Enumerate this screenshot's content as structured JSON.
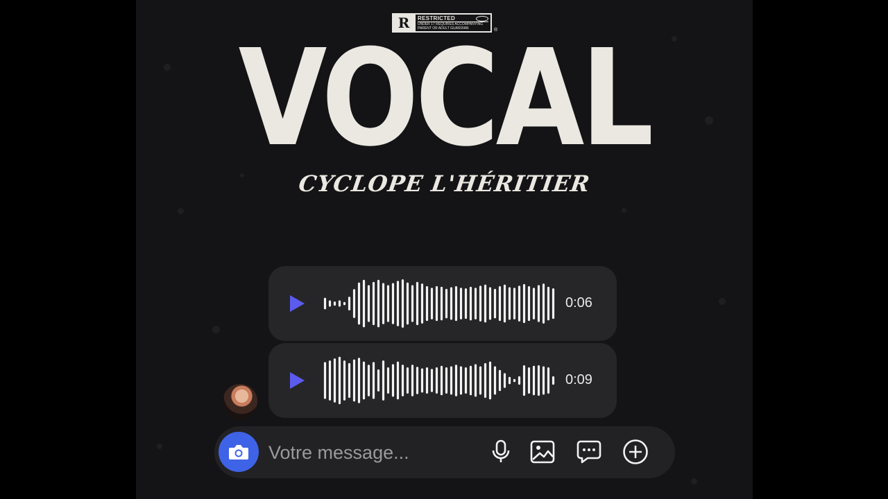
{
  "cover": {
    "advisory": {
      "letter": "R",
      "title": "RESTRICTED",
      "note_line1": "UNDER 17 REQUIRES ACCOMPANYING",
      "note_line2": "PARENT OR ADULT GUARDIAN",
      "registered": "®"
    },
    "title": "VOCAL",
    "artist": "CYCLOPE L'HÉRITIER"
  },
  "messages": [
    {
      "duration": "0:06",
      "waveform": [
        0.22,
        0.12,
        0.08,
        0.12,
        0.06,
        0.26,
        0.55,
        0.8,
        0.9,
        0.7,
        0.82,
        0.9,
        0.78,
        0.7,
        0.78,
        0.86,
        0.92,
        0.8,
        0.7,
        0.82,
        0.76,
        0.66,
        0.6,
        0.66,
        0.64,
        0.56,
        0.62,
        0.66,
        0.6,
        0.58,
        0.64,
        0.6,
        0.68,
        0.72,
        0.62,
        0.56,
        0.66,
        0.72,
        0.62,
        0.6,
        0.68,
        0.74,
        0.66,
        0.6,
        0.7,
        0.76,
        0.64,
        0.58
      ]
    },
    {
      "duration": "0:09",
      "waveform": [
        0.7,
        0.76,
        0.84,
        0.9,
        0.76,
        0.66,
        0.8,
        0.86,
        0.72,
        0.6,
        0.7,
        0.42,
        0.76,
        0.5,
        0.62,
        0.72,
        0.6,
        0.5,
        0.6,
        0.52,
        0.46,
        0.5,
        0.44,
        0.5,
        0.56,
        0.5,
        0.54,
        0.6,
        0.54,
        0.5,
        0.56,
        0.62,
        0.54,
        0.66,
        0.72,
        0.54,
        0.4,
        0.28,
        0.14,
        0.06,
        0.16,
        0.58,
        0.5,
        0.56,
        0.58,
        0.54,
        0.5,
        0.16
      ]
    }
  ],
  "composer": {
    "placeholder": "Votre message..."
  },
  "icons": {
    "camera": "camera-icon",
    "mic": "microphone-icon",
    "gallery": "image-icon",
    "chat": "chat-bubble-icon",
    "add": "plus-circle-icon",
    "play": "play-icon"
  },
  "colors": {
    "accent": "#3f63e6",
    "play": "#5b5bf0",
    "background": "#141416",
    "bubble": "#262628",
    "title": "#ebe8e2"
  }
}
